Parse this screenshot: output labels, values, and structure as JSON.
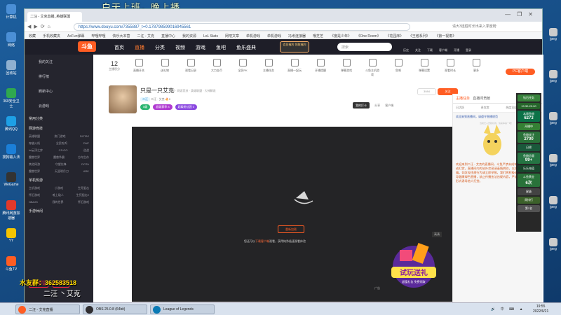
{
  "overlay": {
    "title": "白天上班，晚上播"
  },
  "desktop_left": [
    {
      "label": "计算机",
      "color": "#4b8fd6"
    },
    {
      "label": "网络",
      "color": "#4b8fd6"
    },
    {
      "label": "回收站",
      "color": "#8fb0d0"
    },
    {
      "label": "360安全卫士",
      "color": "#2fa84f"
    },
    {
      "label": "腾讯QQ",
      "color": "#1ea0e6"
    },
    {
      "label": "搜狗输入法",
      "color": "#1b7fd8"
    },
    {
      "label": "WeGame",
      "color": "#333333"
    },
    {
      "label": "腾讯网游加速器",
      "color": "#e0392b"
    },
    {
      "label": "YY",
      "color": "#f5c400"
    },
    {
      "label": "斗鱼TV",
      "color": "#ff5d23"
    }
  ],
  "desktop_right": [
    {
      "label": "jpeg",
      "color": "#cccccc"
    },
    {
      "label": "jpeg",
      "color": "#cccccc"
    },
    {
      "label": "jpeg",
      "color": "#cccccc"
    },
    {
      "label": "jpeg",
      "color": "#cccccc"
    },
    {
      "label": "jpeg",
      "color": "#cccccc"
    },
    {
      "label": "jpeg",
      "color": "#cccccc"
    }
  ],
  "browser": {
    "tab_title": "二汪 - 艾克直播_英雄联盟",
    "url": "https://www.douyu.com/7355887_t=0.178798599016945561",
    "url_right": "请大3连胜时长出来入季度榜",
    "bookmarks": [
      "收藏",
      "手机收藏夹",
      "AcFun弹幕",
      "哔哩哔哩",
      "快乐大本营",
      "二汪 - 艾克",
      "直播中心",
      "我的资源",
      "LoL Stats",
      "网吧文章",
      "单机游戏",
      "单机游戏",
      "冯考连接器",
      "哦芝芝",
      "《度是少年》",
      "《One Room》",
      "《花园床》",
      "《王者系列》",
      "《第一视角》"
    ]
  },
  "douyu_header": {
    "logo": "斗鱼",
    "nav": [
      "首页",
      "直播",
      "分类",
      "视频",
      "游戏",
      "鱼吧",
      "鱼乐盛典"
    ],
    "promo": "会员福利 领取福利",
    "search_placeholder": "搜索",
    "icons": [
      "历史",
      "关注",
      "下载",
      "客户端",
      "开播",
      "登录"
    ]
  },
  "sidebar": {
    "top_items": [
      "我的关注",
      "排行榜",
      "刷新中心",
      "云游戏"
    ],
    "sections": [
      {
        "title": "常用分类",
        "rows": []
      },
      {
        "title": "网游竞技",
        "rows": [
          [
            "英雄联盟",
            "热门游戏",
            "DOTA2"
          ],
          [
            "穿越火线",
            "全民吃鸡",
            "DNF"
          ],
          [
            "lol云顶之弈",
            "CS:GO",
            "逆战"
          ],
          [
            "魔兽世界",
            "魔兽争霸",
            "方舟生存"
          ],
          [
            "其他网游",
            "守望先锋",
            "DOTA"
          ],
          [
            "魔兽世界",
            "天涯明月刀",
            "ARK"
          ]
        ]
      },
      {
        "title": "单机热游",
        "rows": [
          [
            "主机游戏",
            "小游戏",
            "生死狙击"
          ],
          [
            "怀旧游戏",
            "唯上敌人",
            "生死狙击2"
          ],
          [
            "NBA2K",
            "我的世界",
            "怀旧游戏"
          ]
        ]
      },
      {
        "title": "手游休闲",
        "rows": []
      }
    ],
    "bottom_buttons": [
      "客户端下载",
      "公会中心"
    ]
  },
  "icon_row": {
    "count": "12",
    "count_label": "主播积分",
    "items": [
      "直播开关",
      "送礼物",
      "观看记录",
      "大力金币",
      "全民PK",
      "主播任务",
      "直播一起玩",
      "开播提醒",
      "弹幕游戏",
      "斗鱼主机游戏",
      "鱼吧",
      "弹幕设置",
      "观看时长",
      "更多"
    ],
    "pc_button": "PC客户端"
  },
  "streamer": {
    "name": "只是一只艾克",
    "meta": "举报  · 网游竞技 · 英雄联盟 · 大神解说",
    "tag": "二汪",
    "sub": "二汪 · 艾克  🔥0",
    "badges": [
      {
        "label": "5级",
        "color": "#2bb673"
      },
      {
        "label": "超级赛季 8",
        "color": "#b03ad1"
      },
      {
        "label": "超级粉丝团 0",
        "color": "#8a47e0"
      }
    ],
    "follow_count": "3084",
    "follow_label": "关注",
    "share_labels": [
      "分享",
      "客户端"
    ],
    "dark_button": "我的打卡"
  },
  "player": {
    "open_button": "重新加载",
    "tip_prefix": "您还可以",
    "tip_link": "下载客户端",
    "tip_suffix": "观看，获得纯净极速观看体验",
    "corner": "高清",
    "gift_title": "试玩送礼",
    "gift_sub": "超值礼包 免费领取",
    "ad_label": "广告"
  },
  "chat": {
    "tabs": [
      "主播任务",
      "直播间贡献"
    ],
    "subtabs": [
      "日活跃",
      "贵宾席",
      "热度贡献",
      "房管"
    ],
    "hint": "欢迎来到直播间，请遵守直播规范",
    "empty_text": "当前无人贡献礼物，快来争第一吧！",
    "message": "欢迎来到二汪 - 艾克的直播间，斗鱼严禁未成年人直播或打赏，直播间内的站外交易请谨慎辨别，以防上当受骗。如发现违规行为请立即举报，我们将积极处理。倡导健康绿色直播，禁止传播违法违规内容，严禁以任何形式诱导他人打赏。"
  },
  "right_overlay": {
    "blocks": [
      {
        "label": "钻石任务",
        "value": "",
        "color": "#2e7d32"
      },
      {
        "label": "19:30-20:00",
        "value": "",
        "color": "#1b5e20"
      },
      {
        "label": "本周鱼翅",
        "value": "6273",
        "color": "#006b3f"
      },
      {
        "label": "开播中",
        "value": "",
        "color": "#2a7a2a"
      },
      {
        "label": "鱼翅关注",
        "value": "2700",
        "color": "#206b30"
      },
      {
        "label": "日榜",
        "value": "",
        "color": "#0f5132"
      },
      {
        "label": "鱼翅总量",
        "value": "99+",
        "color": "#1a6e3a"
      },
      {
        "label": "乐乐充值",
        "value": "",
        "color": "#0d3e23"
      },
      {
        "label": "斗鱼黄金",
        "value": "6次",
        "color": "#1f6b30"
      },
      {
        "label": "星级",
        "value": "",
        "color": "#3a3a3a"
      },
      {
        "label": "周排行",
        "value": "",
        "color": "#335a20"
      },
      {
        "label": "第1名",
        "value": "",
        "color": "#4b4b4b"
      }
    ]
  },
  "streamer_overlay": {
    "qq": "水友群：362583518",
    "name": "二汪 丶艾克"
  },
  "taskbar": {
    "items": [
      {
        "label": "二汪 - 艾克直播",
        "color": "#ff5d23"
      },
      {
        "label": "OBS 25.0.8 (64bit)",
        "color": "#302e31"
      },
      {
        "label": "League of Legends",
        "color": "#0a7ab5"
      }
    ],
    "tray": "🔊 中 ⌨ ▲",
    "time": "19:55",
    "date": "2022/6/21"
  }
}
